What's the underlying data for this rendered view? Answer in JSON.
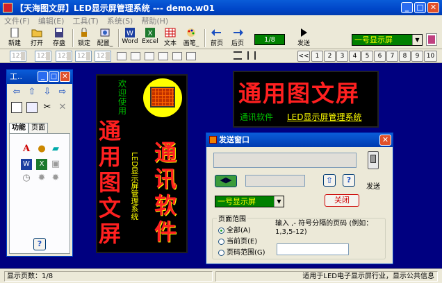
{
  "window": {
    "title": "【天海图文屏】LED显示屏管理系统 --- demo.w01",
    "minimize": "_",
    "maximize": "□",
    "close": "✕"
  },
  "menu": [
    "文件(F)",
    "编辑(E)",
    "工具(T)",
    "系统(S)",
    "帮助(H)"
  ],
  "toolbar": {
    "new": "新建",
    "open": "打开",
    "save": "存盘",
    "lock": "锁定",
    "config": "配置_",
    "word": "Word",
    "excel": "Excel",
    "text": "文本",
    "draw": "画笔_",
    "prev": "前页",
    "next": "后页",
    "page_indicator": "1/8",
    "send": "发送"
  },
  "screen_select": {
    "value": "一号显示屏"
  },
  "spinners": [
    "123",
    "123",
    "123",
    "123",
    "123"
  ],
  "pager": {
    "first": "<<",
    "pages": [
      "1",
      "2",
      "3",
      "4",
      "5",
      "6",
      "7",
      "8",
      "9",
      "10"
    ],
    "last": ">>"
  },
  "tool_panel": {
    "title": "工..",
    "tab_function": "功能",
    "tab_page": "页面",
    "help": "?"
  },
  "canvas_tall": {
    "small_text": "欢迎使用",
    "big_left": "通用图文屏",
    "vertical_small": "LED显示屏管理系统",
    "big_right": "通讯软件"
  },
  "canvas_wide": {
    "headline": "通用图文屏",
    "sub_left": "通讯软件",
    "sub_right": "LED显示屏管理系统"
  },
  "send_dialog": {
    "title": "发送窗口",
    "send_label": "发送",
    "screen_select": "一号显示屏",
    "close_button": "关闭",
    "range_group": "页面范围",
    "opt_all": "全部(A)",
    "opt_current": "当前页(E)",
    "opt_range": "页码范围(G)",
    "hint": "输入 ,- 符号分隔的页码 (例如：1,3,5-12)",
    "range_value": ""
  },
  "status": {
    "pages": "显示页数：1/8",
    "info": "适用于LED电子显示屏行业，显示公共信息"
  },
  "colors": {
    "canvas_bg": "#000000",
    "accent_red": "#ff2020",
    "accent_yellow": "#ffff00",
    "accent_green": "#00c000"
  }
}
